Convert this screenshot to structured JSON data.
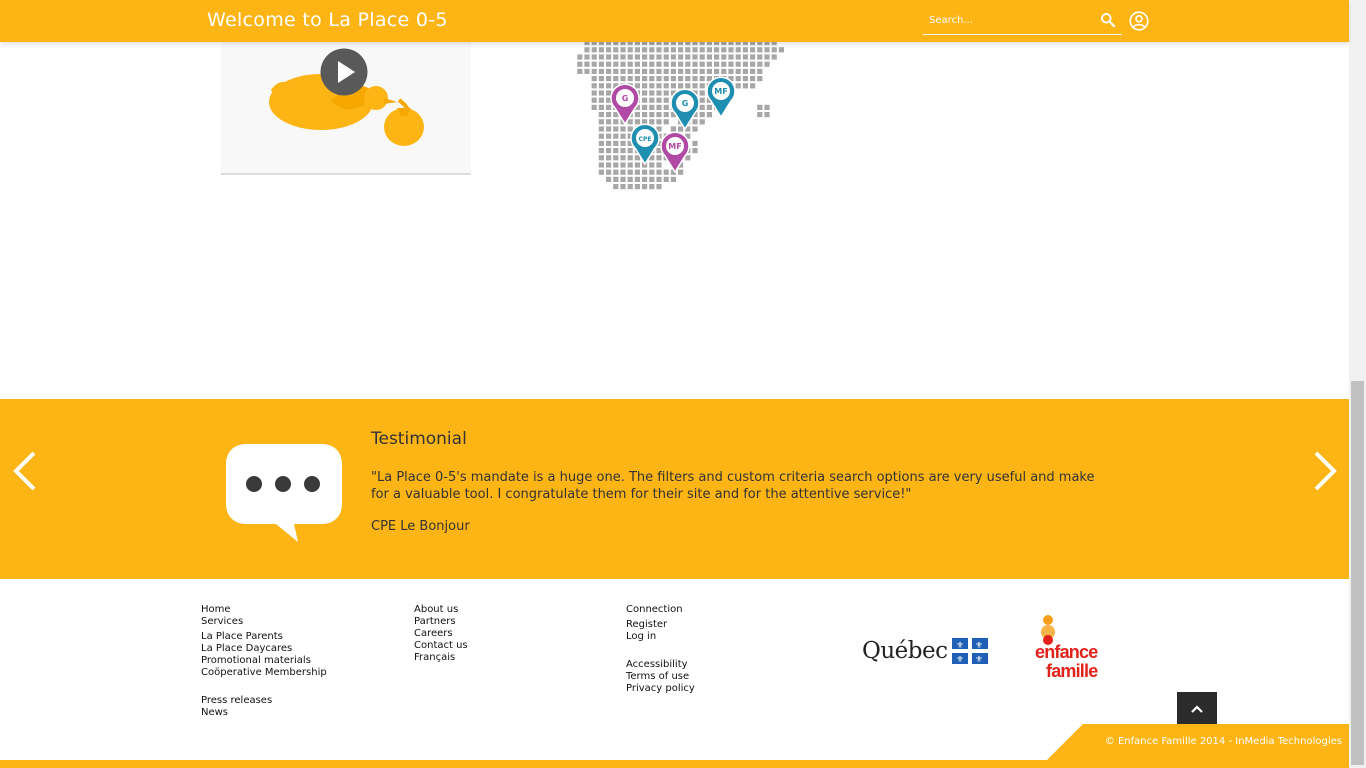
{
  "header": {
    "title": "Welcome to La Place 0-5",
    "search_placeholder": "Search..."
  },
  "map_markers": [
    "G",
    "G",
    "MF",
    "CPE",
    "MF"
  ],
  "testimonial": {
    "heading": "Testimonial",
    "quote": "\"La Place 0-5's mandate is a huge one. The filters and custom criteria search options are very useful and make for a valuable tool. I congratulate them for their site and for the attentive service!\"",
    "author": "CPE Le Bonjour"
  },
  "footer": {
    "col1": {
      "home": "Home",
      "services": "Services",
      "parents": "La Place Parents",
      "daycares": "La Place Daycares",
      "promo": "Promotional materials",
      "coop": "Coöperative Membership",
      "press": "Press releases",
      "news": "News"
    },
    "col2": {
      "about": "About us",
      "partners": "Partners",
      "careers": "Careers",
      "contact": "Contact us",
      "francais": "Français"
    },
    "col3": {
      "connection": "Connection",
      "register": "Register",
      "login": "Log in",
      "accessibility": "Accessibility",
      "terms": "Terms of use",
      "privacy": "Privacy policy"
    },
    "quebec_logo": "Québec",
    "ef_logo_line1": "enfance",
    "ef_logo_line2": "famille",
    "copyright": "© Enfance Famille 2014 - InMedia Technologies"
  },
  "colors": {
    "brand_yellow": "#fdb515",
    "map_teal": "#1e8fb0",
    "map_magenta": "#b04aa5",
    "logo_red": "#e2231a"
  },
  "icons": {
    "search": "search-icon",
    "user": "user-account-icon",
    "play": "play-icon",
    "prev": "chevron-left-icon",
    "next": "chevron-right-icon",
    "speech": "speech-bubble-icon",
    "top": "chevron-up-icon"
  }
}
